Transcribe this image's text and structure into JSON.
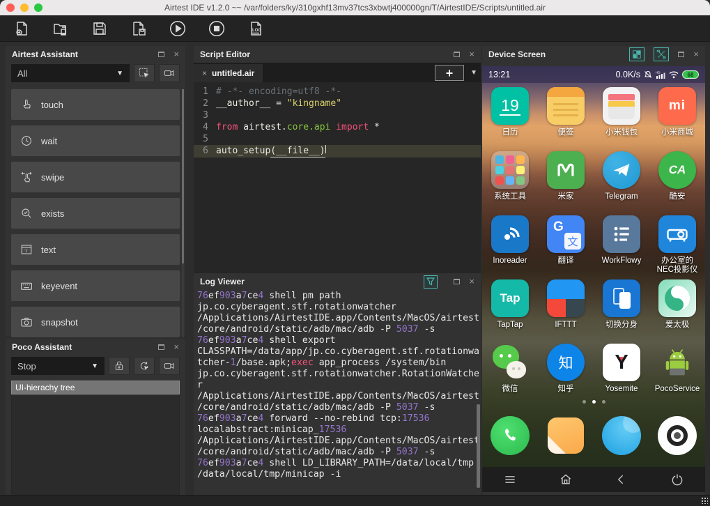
{
  "window": {
    "title": "Airtest IDE v1.2.0 ~~ /var/folders/ky/310gxhf13mv37tcs3xbwtj400000gn/T/AirtestIDE/Scripts/untitled.air"
  },
  "colors": {
    "accent_teal": "#4db6ac",
    "log_number_purple": "#9575cd",
    "keyword_pink": "#f7527a",
    "string_yellow": "#d8d06c",
    "module_green": "#87c540",
    "comment_gray": "#697076"
  },
  "toolbar": {
    "buttons": [
      "new-script",
      "open-script",
      "save-script",
      "save-as-script",
      "run-script",
      "stop-script",
      "view-log"
    ]
  },
  "airtest_assistant": {
    "title": "Airtest Assistant",
    "filter_value": "All",
    "tools": [
      "snippet",
      "record"
    ],
    "actions": [
      {
        "label": "touch",
        "icon": "touch"
      },
      {
        "label": "wait",
        "icon": "wait"
      },
      {
        "label": "swipe",
        "icon": "swipe"
      },
      {
        "label": "exists",
        "icon": "exists"
      },
      {
        "label": "text",
        "icon": "text"
      },
      {
        "label": "keyevent",
        "icon": "keyevent"
      },
      {
        "label": "snapshot",
        "icon": "snapshot"
      }
    ]
  },
  "poco_assistant": {
    "title": "Poco Assistant",
    "mode_value": "Stop",
    "tools": [
      "lock",
      "refresh",
      "record"
    ],
    "tree_header": "UI-hierachy tree"
  },
  "script_editor": {
    "title": "Script Editor",
    "tab_label": "untitled.air",
    "new_tab_label": "+",
    "code_lines": [
      {
        "no": "1",
        "segments": [
          {
            "t": "# -*- encoding=utf8 -*-",
            "c": "comment"
          }
        ]
      },
      {
        "no": "2",
        "segments": [
          {
            "t": "__author__ = ",
            "c": "plain"
          },
          {
            "t": "\"kingname\"",
            "c": "string"
          }
        ]
      },
      {
        "no": "3",
        "segments": []
      },
      {
        "no": "4",
        "segments": [
          {
            "t": "from ",
            "c": "keyword"
          },
          {
            "t": "airtest.",
            "c": "plain"
          },
          {
            "t": "core.api",
            "c": "green"
          },
          {
            "t": " import",
            "c": "keyword"
          },
          {
            "t": " *",
            "c": "plain"
          }
        ]
      },
      {
        "no": "5",
        "segments": []
      },
      {
        "no": "6",
        "current": true,
        "segments": [
          {
            "t": "auto_setup",
            "c": "plain"
          },
          {
            "t": "(__file__)",
            "c": "plain",
            "u": true
          }
        ]
      }
    ]
  },
  "log_viewer": {
    "title": "Log Viewer",
    "lines": [
      "76ef903a7ce4 shell pm path",
      "jp.co.cyberagent.stf.rotationwatcher",
      "/Applications/AirtestIDE.app/Contents/MacOS/airtest",
      "/core/android/static/adb/mac/adb -P 5037 -s",
      "76ef903a7ce4 shell export",
      "CLASSPATH=/data/app/jp.co.cyberagent.stf.rotationwa",
      "tcher-1/base.apk;exec app_process /system/bin",
      "jp.co.cyberagent.stf.rotationwatcher.RotationWatche",
      "r",
      "/Applications/AirtestIDE.app/Contents/MacOS/airtest",
      "/core/android/static/adb/mac/adb -P 5037 -s",
      "76ef903a7ce4 forward --no-rebind tcp:17536",
      "localabstract:minicap_17536",
      "/Applications/AirtestIDE.app/Contents/MacOS/airtest",
      "/core/android/static/adb/mac/adb -P 5037 -s",
      "76ef903a7ce4 shell LD_LIBRARY_PATH=/data/local/tmp",
      "/data/local/tmp/minicap -i"
    ]
  },
  "device_screen": {
    "title": "Device Screen",
    "tools": [
      "layout-grid",
      "toolbox"
    ],
    "statusbar": {
      "time": "13:21",
      "net_speed": "0.0K/s",
      "battery_percent": "68"
    },
    "app_rows": [
      [
        {
          "label": "日历",
          "icon": "calendar"
        },
        {
          "label": "便签",
          "icon": "notes"
        },
        {
          "label": "小米钱包",
          "icon": "wallet"
        },
        {
          "label": "小米商城",
          "icon": "mistore"
        }
      ],
      [
        {
          "label": "系统工具",
          "icon": "folder"
        },
        {
          "label": "米家",
          "icon": "mihome"
        },
        {
          "label": "Telegram",
          "icon": "telegram"
        },
        {
          "label": "酷安",
          "icon": "kuan"
        }
      ],
      [
        {
          "label": "Inoreader",
          "icon": "inoreader"
        },
        {
          "label": "翻译",
          "icon": "translate"
        },
        {
          "label": "WorkFlowy",
          "icon": "workflowy"
        },
        {
          "label": "办公室的\nNEC投影仪",
          "icon": "projector"
        }
      ],
      [
        {
          "label": "TapTap",
          "icon": "taptap"
        },
        {
          "label": "IFTTT",
          "icon": "ifttt"
        },
        {
          "label": "切换分身",
          "icon": "clone"
        },
        {
          "label": "爱太极",
          "icon": "taiji"
        }
      ],
      [
        {
          "label": "微信",
          "icon": "wechat"
        },
        {
          "label": "知乎",
          "icon": "zhihu"
        },
        {
          "label": "Yosemite",
          "icon": "yosemite"
        },
        {
          "label": "PocoService",
          "icon": "poco"
        }
      ]
    ],
    "page_dots": {
      "count": 3,
      "active_index": 1
    },
    "dock": [
      {
        "icon": "phone"
      },
      {
        "icon": "messages"
      },
      {
        "icon": "browser"
      },
      {
        "icon": "camera"
      }
    ],
    "nav": [
      "menu",
      "home",
      "back",
      "power"
    ]
  },
  "app_icon_text": {
    "calendar_day": "19",
    "mistore_logo": "mi",
    "kuan_logo": "CA",
    "translate_g": "G",
    "translate_char": "文",
    "taptap_logo": "Tap",
    "zhihu_char": "知",
    "yosemite_letter": "Y"
  }
}
